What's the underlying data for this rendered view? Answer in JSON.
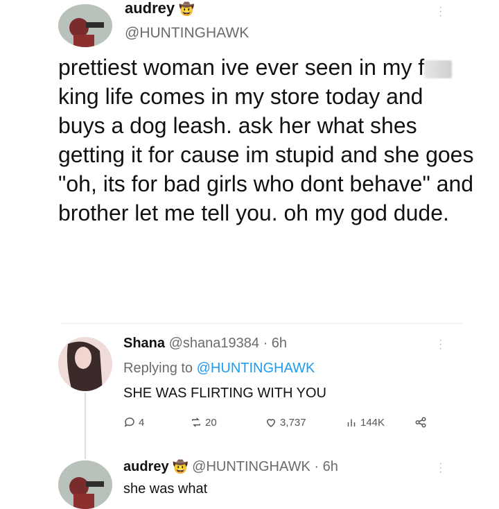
{
  "tweet": {
    "display_name": "audrey",
    "handle": "@HUNTINGHAWK",
    "text_before": "prettiest woman ive ever seen in my f",
    "text_after": "king life comes in my store today and buys a dog leash. ask her what shes getting it for cause im stupid and she goes \"oh, its for bad girls who dont behave\" and brother let me tell you. oh my god dude.",
    "badge_icon": "cowboy-emoji-icon"
  },
  "reply1": {
    "display_name": "Shana",
    "handle": "@shana19384",
    "time": "· 6h",
    "replying_label": "Replying to",
    "replying_handle": "@HUNTINGHAWK",
    "text": "SHE WAS FLIRTING WITH YOU",
    "stats": {
      "replies": "4",
      "retweets": "20",
      "likes": "3,737",
      "views": "144K"
    }
  },
  "reply2": {
    "display_name": "audrey",
    "handle": "@HUNTINGHAWK",
    "time": "· 6h",
    "text": "she was what"
  },
  "colors": {
    "link": "#1d9bf0",
    "muted": "#6b6b6b"
  }
}
